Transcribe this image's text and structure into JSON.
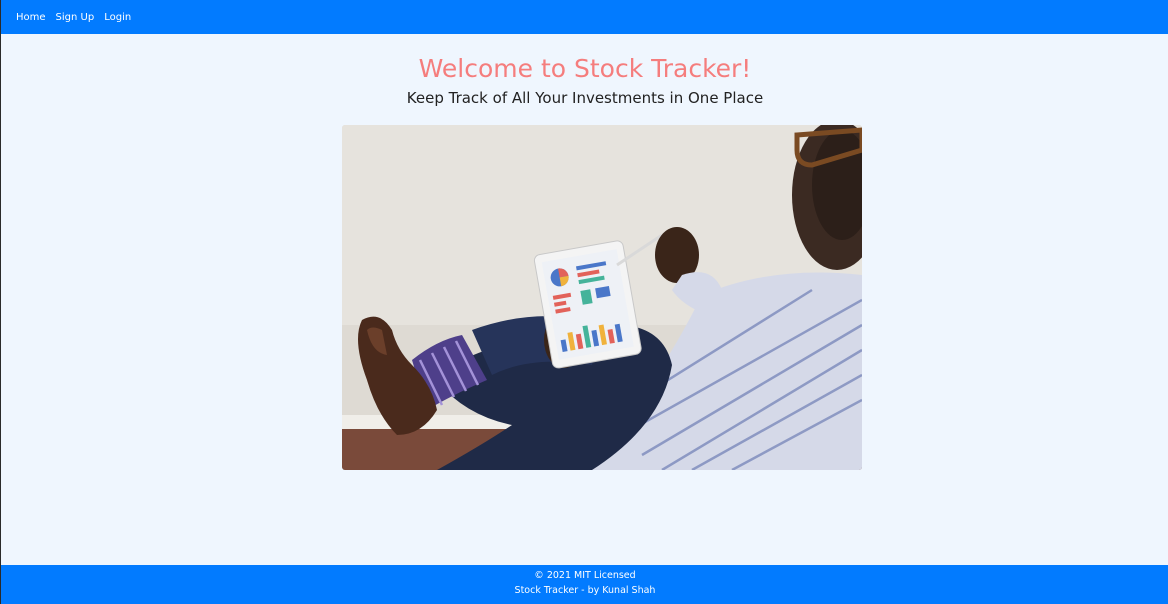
{
  "nav": {
    "items": [
      {
        "label": "Home"
      },
      {
        "label": "Sign Up"
      },
      {
        "label": "Login"
      }
    ]
  },
  "main": {
    "title": "Welcome to Stock Tracker!",
    "subtitle": "Keep Track of All Your Investments in One Place",
    "hero_image": "person-holding-tablet-with-charts"
  },
  "footer": {
    "copyright": "© 2021 MIT Licensed",
    "credit": "Stock Tracker - by Kunal Shah"
  },
  "colors": {
    "brand": "#027bff",
    "title": "#f57d7d",
    "background": "#eff6fe"
  }
}
